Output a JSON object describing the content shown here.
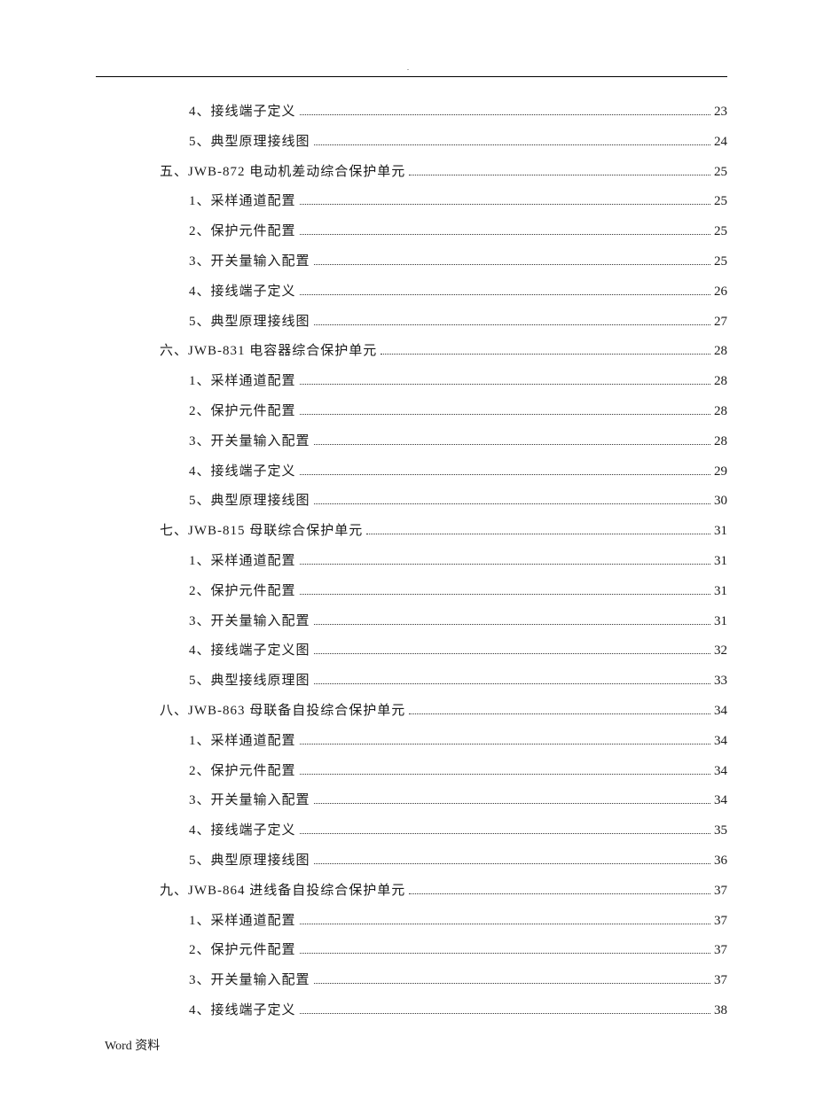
{
  "footer": "Word 资料",
  "toc": [
    {
      "level": 2,
      "label": "4、接线端子定义",
      "page": "23"
    },
    {
      "level": 2,
      "label": "5、典型原理接线图",
      "page": "24"
    },
    {
      "level": 1,
      "label": "五、JWB-872 电动机差动综合保护单元",
      "page": "25"
    },
    {
      "level": 2,
      "label": "1、采样通道配置",
      "page": "25"
    },
    {
      "level": 2,
      "label": "2、保护元件配置",
      "page": "25"
    },
    {
      "level": 2,
      "label": "3、开关量输入配置",
      "page": "25"
    },
    {
      "level": 2,
      "label": "4、接线端子定义",
      "page": "26"
    },
    {
      "level": 2,
      "label": "5、典型原理接线图",
      "page": "27"
    },
    {
      "level": 1,
      "label": "六、JWB-831 电容器综合保护单元",
      "page": "28"
    },
    {
      "level": 2,
      "label": "1、采样通道配置",
      "page": "28"
    },
    {
      "level": 2,
      "label": "2、保护元件配置",
      "page": "28"
    },
    {
      "level": 2,
      "label": "3、开关量输入配置",
      "page": "28"
    },
    {
      "level": 2,
      "label": "4、接线端子定义",
      "page": "29"
    },
    {
      "level": 2,
      "label": "5、典型原理接线图",
      "page": "30"
    },
    {
      "level": 1,
      "label": "七、JWB-815 母联综合保护单元",
      "page": "31"
    },
    {
      "level": 2,
      "label": "1、采样通道配置",
      "page": "31"
    },
    {
      "level": 2,
      "label": "2、保护元件配置",
      "page": "31"
    },
    {
      "level": 2,
      "label": "3、开关量输入配置",
      "page": "31"
    },
    {
      "level": 2,
      "label": "4、接线端子定义图",
      "page": "32"
    },
    {
      "level": 2,
      "label": "5、典型接线原理图",
      "page": "33"
    },
    {
      "level": 1,
      "label": "八、JWB-863 母联备自投综合保护单元",
      "page": "34"
    },
    {
      "level": 2,
      "label": "1、采样通道配置",
      "page": "34"
    },
    {
      "level": 2,
      "label": "2、保护元件配置",
      "page": "34"
    },
    {
      "level": 2,
      "label": "3、开关量输入配置",
      "page": "34"
    },
    {
      "level": 2,
      "label": "4、接线端子定义",
      "page": "35"
    },
    {
      "level": 2,
      "label": "5、典型原理接线图",
      "page": "36"
    },
    {
      "level": 1,
      "label": "九、JWB-864 进线备自投综合保护单元",
      "page": "37"
    },
    {
      "level": 2,
      "label": "1、采样通道配置",
      "page": "37"
    },
    {
      "level": 2,
      "label": "2、保护元件配置",
      "page": "37"
    },
    {
      "level": 2,
      "label": "3、开关量输入配置",
      "page": "37"
    },
    {
      "level": 2,
      "label": "4、接线端子定义",
      "page": "38"
    }
  ]
}
